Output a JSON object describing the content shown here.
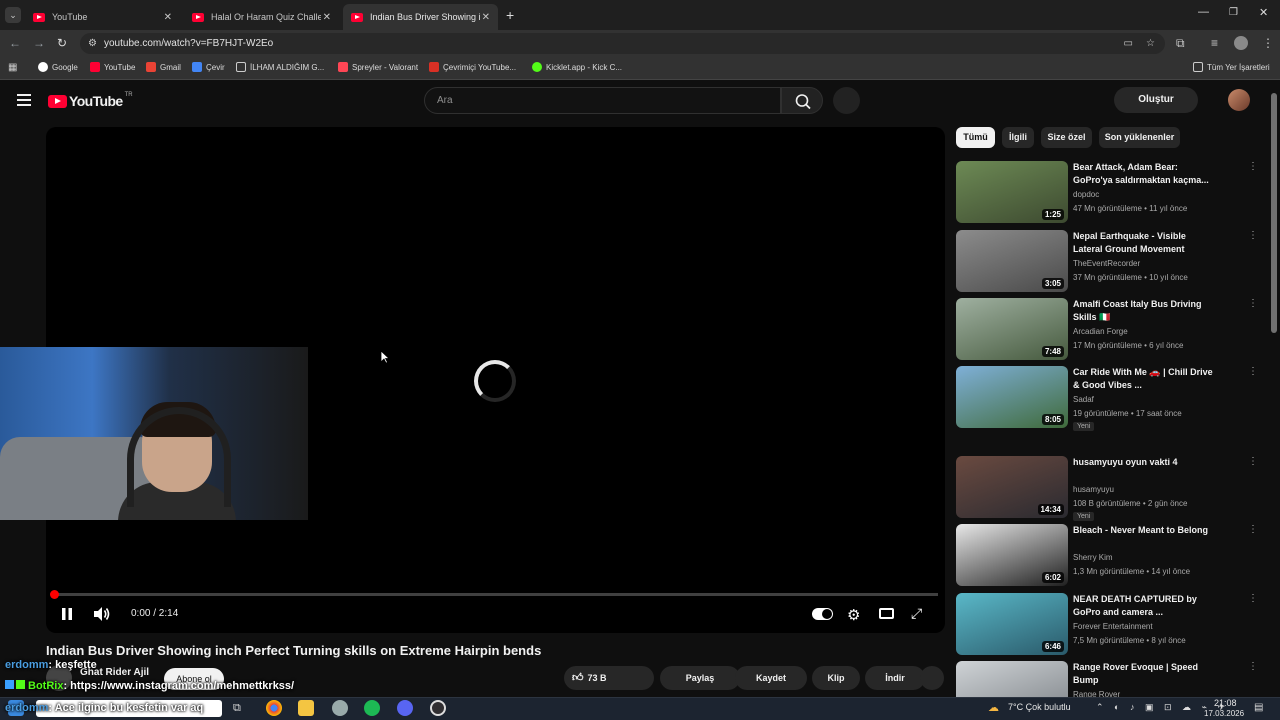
{
  "browser": {
    "tabs": [
      {
        "title": "YouTube"
      },
      {
        "title": "Halal Or Haram Quiz Challenge"
      },
      {
        "title": "Indian Bus Driver Showing inch"
      }
    ],
    "url": "youtube.com/watch?v=FB7HJT-W2Eo",
    "bookmarks": [
      "Google",
      "YouTube",
      "Gmail",
      "Çevir",
      "İLHAM ALDIĞIM G...",
      "Spreyler - Valorant",
      "Çevrimiçi YouTube...",
      "Kicklet.app - Kick C..."
    ],
    "all_bookmarks": "Tüm Yer İşaretleri"
  },
  "youtube": {
    "logo": "YouTube",
    "region": "TR",
    "search_placeholder": "Ara",
    "create": "Oluştur"
  },
  "player": {
    "time": "0:00 / 2:14",
    "progress": 0
  },
  "video": {
    "title": "Indian Bus Driver Showing inch Perfect Turning skills on Extreme Hairpin bends",
    "channel": "Ghat Rider Ajil",
    "subscribe": "Abone ol",
    "likes": "73 B",
    "share": "Paylaş",
    "save": "Kaydet",
    "clip": "Klip",
    "download": "İndir"
  },
  "chat": [
    {
      "user": "erdomm",
      "text": ": keşfette"
    },
    {
      "user": "BotRix",
      "text": ": https://www.instagram.com/mehmettkrkss/"
    },
    {
      "user": "erdomm",
      "text": ": Ace ilginc bu kesfetin var aq"
    }
  ],
  "chips": [
    "Tümü",
    "İlgili",
    "Size özel",
    "Son yüklenenler"
  ],
  "recommendations": [
    {
      "title": "Bear Attack, Adam Bear: GoPro'ya saldırmaktan kaçma...",
      "channel": "dopdoc",
      "meta": "47 Mn görüntüleme • 11 yıl önce",
      "duration": "1:25",
      "badge": "",
      "color1": "#6d8a55",
      "color2": "#3d4a30"
    },
    {
      "title": "Nepal Earthquake - Visible Lateral Ground Movement",
      "channel": "TheEventRecorder",
      "meta": "37 Mn görüntüleme • 10 yıl önce",
      "duration": "3:05",
      "badge": "",
      "color1": "#8c8c8c",
      "color2": "#4a4a4a"
    },
    {
      "title": "Amalfi Coast Italy Bus Driving Skills 🇮🇹",
      "channel": "Arcadian Forge",
      "meta": "17 Mn görüntüleme • 6 yıl önce",
      "duration": "7:48",
      "badge": "",
      "color1": "#9fb0a0",
      "color2": "#465a3e"
    },
    {
      "title": "Car Ride With Me 🚗 | Chill Drive & Good Vibes ...",
      "channel": "Sadaf",
      "meta": "19 görüntüleme • 17 saat önce",
      "duration": "8:05",
      "badge": "Yeni",
      "color1": "#7fb0d8",
      "color2": "#3f6a3a"
    },
    {
      "title": "husamyuyu oyun vakti 4",
      "channel": "husamyuyu",
      "meta": "108 B görüntüleme • 2 gün önce",
      "duration": "14:34",
      "badge": "Yeni",
      "color1": "#6a4a40",
      "color2": "#2a2a30"
    },
    {
      "title": "Bleach - Never Meant to Belong",
      "channel": "Sherry Kim",
      "meta": "1,3 Mn görüntüleme • 14 yıl önce",
      "duration": "6:02",
      "badge": "",
      "color1": "#e8e8e8",
      "color2": "#202020"
    },
    {
      "title": "NEAR DEATH CAPTURED by GoPro and camera ...",
      "channel": "Forever Entertainment",
      "meta": "7,5 Mn görüntüleme • 8 yıl önce",
      "duration": "6:46",
      "badge": "",
      "color1": "#5ab8c8",
      "color2": "#2a5a6a"
    },
    {
      "title": "Range Rover Evoque | Speed Bump",
      "channel": "Range Rover",
      "meta": "",
      "duration": "",
      "badge": "",
      "color1": "#cfd3d6",
      "color2": "#7a7f84"
    }
  ],
  "taskbar": {
    "weather": "7°C  Çok bulutlu",
    "time": "21:08",
    "date": "17.03.2026"
  }
}
